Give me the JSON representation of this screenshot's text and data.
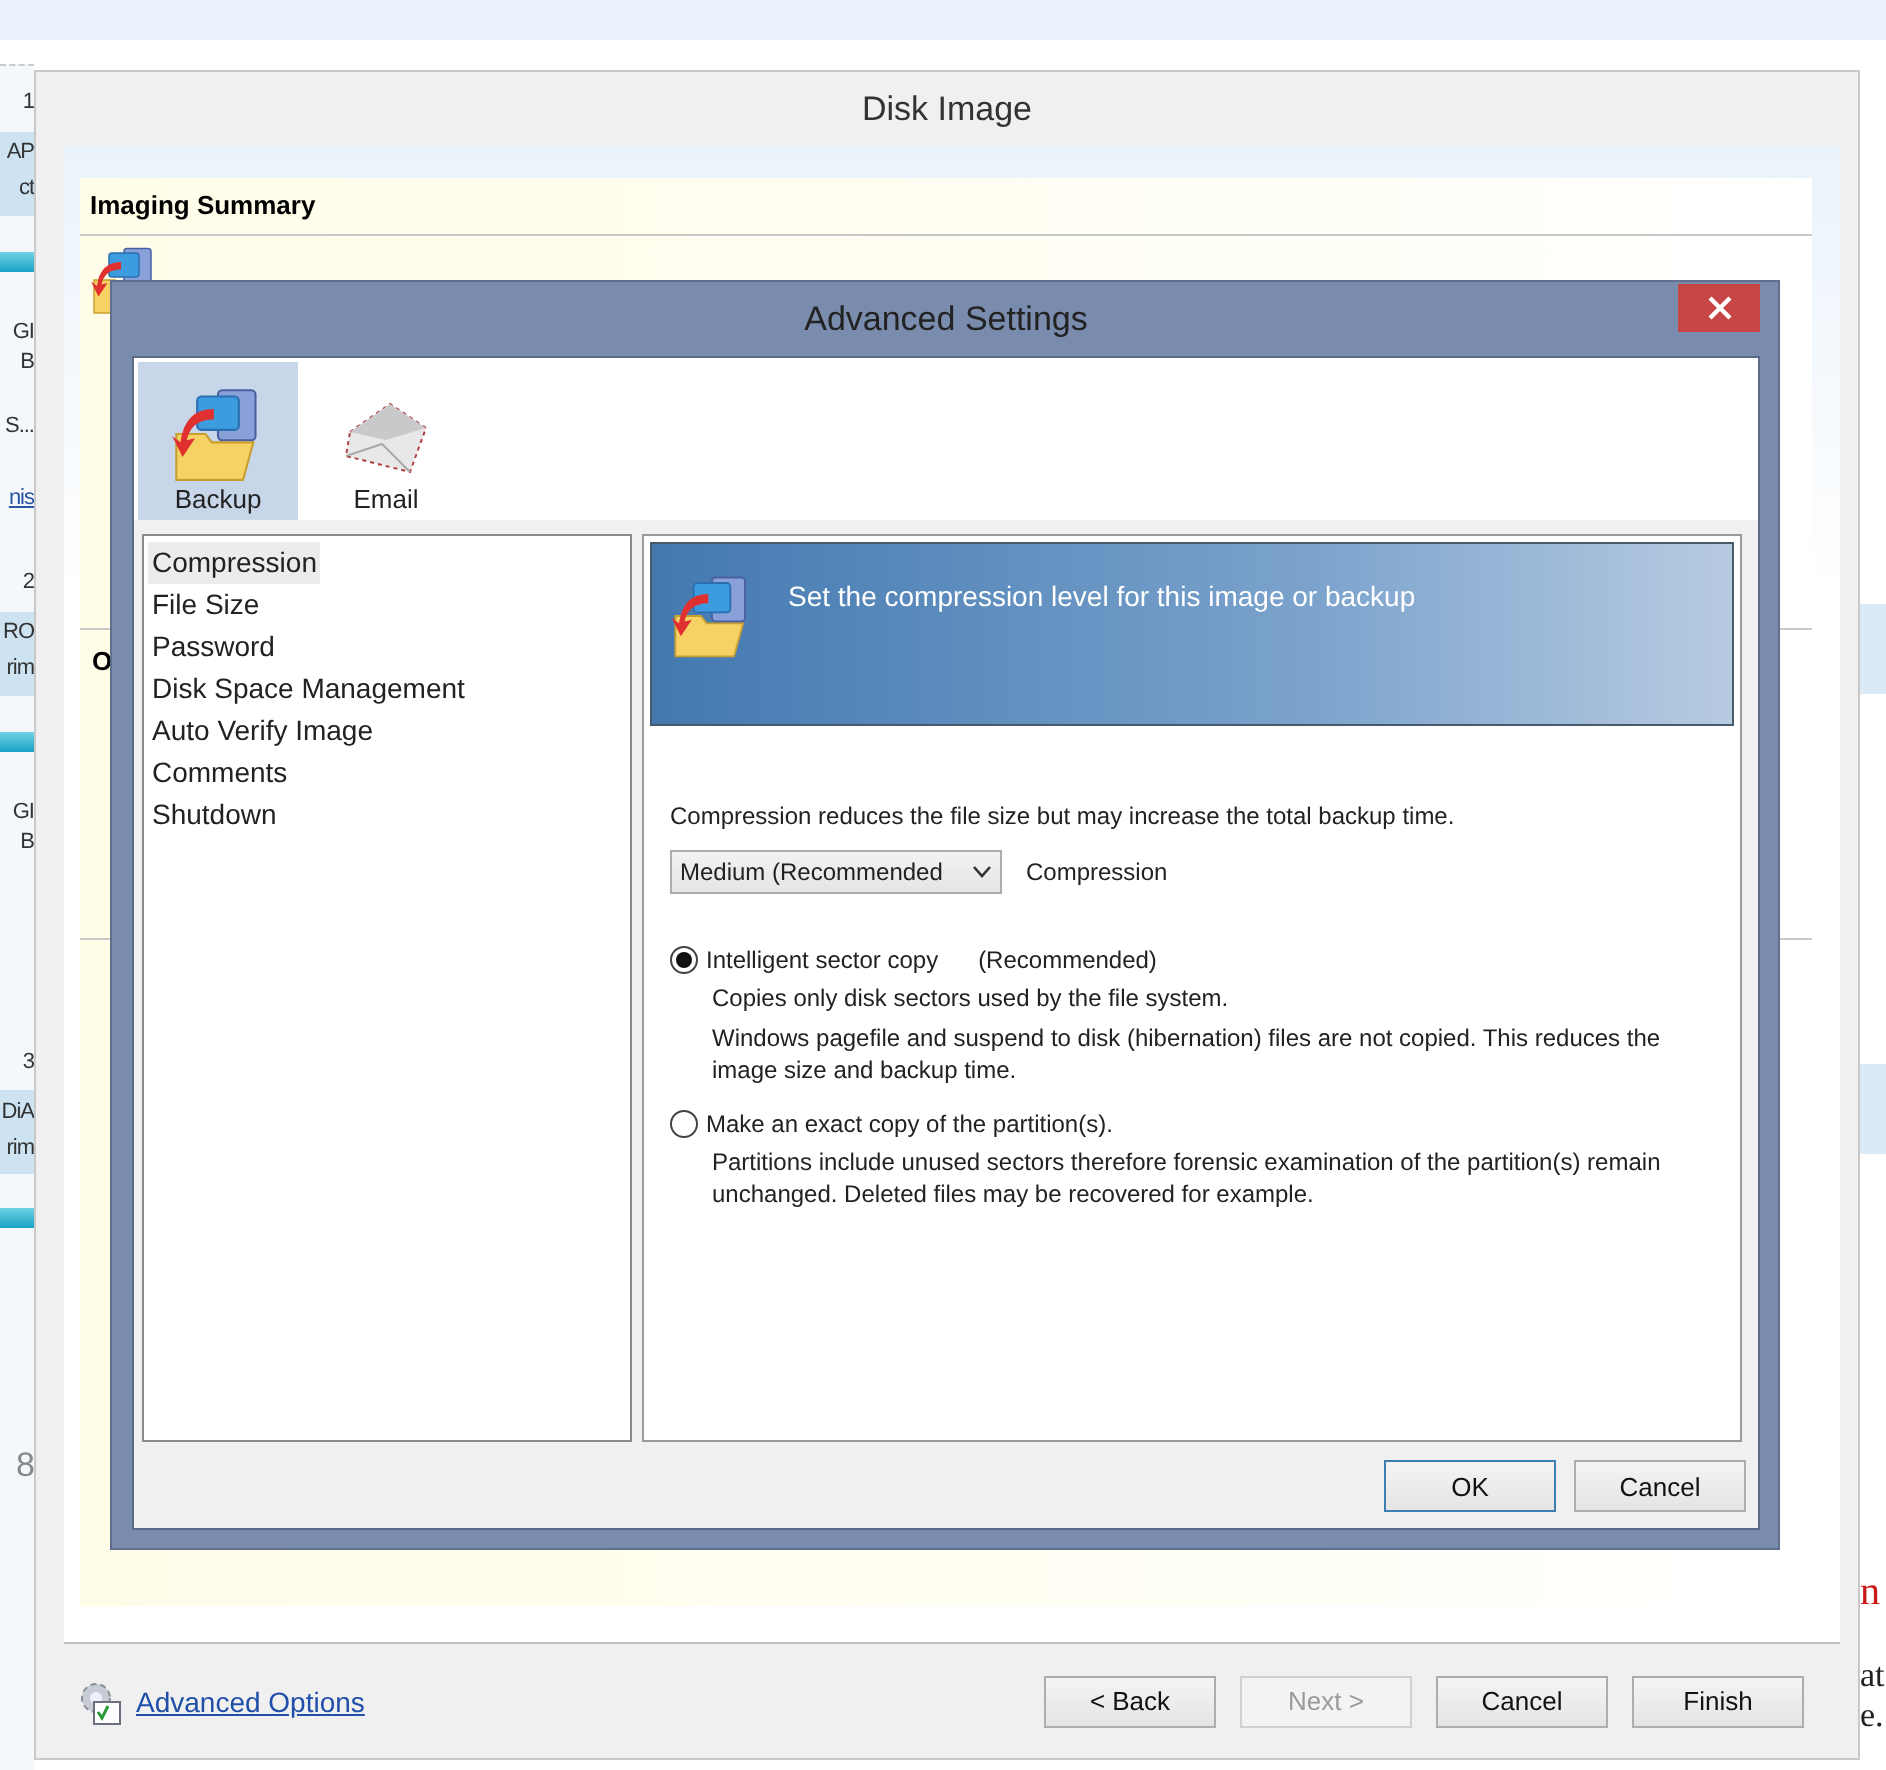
{
  "background_page": {
    "left_fragments": [
      {
        "text": "1",
        "kind": "text"
      },
      {
        "text": "AP",
        "kind": "text"
      },
      {
        "text": "ct",
        "kind": "text"
      },
      {
        "text": "GI",
        "kind": "text"
      },
      {
        "text": "B",
        "kind": "text"
      },
      {
        "text": "S...",
        "kind": "text"
      },
      {
        "text": "nis",
        "kind": "link"
      },
      {
        "text": "2",
        "kind": "text"
      },
      {
        "text": "RO",
        "kind": "text"
      },
      {
        "text": "rim",
        "kind": "text"
      },
      {
        "text": "GI",
        "kind": "text"
      },
      {
        "text": "B",
        "kind": "text"
      },
      {
        "text": "3",
        "kind": "text"
      },
      {
        "text": "DiA",
        "kind": "text"
      },
      {
        "text": "rim",
        "kind": "text"
      },
      {
        "text": "8",
        "kind": "number"
      }
    ],
    "right_fragments": [
      {
        "text": "n",
        "kind": "heading"
      },
      {
        "text": "at",
        "kind": "text"
      },
      {
        "text": "e.",
        "kind": "text"
      }
    ]
  },
  "window": {
    "title": "Disk Image",
    "summary": {
      "title": "Imaging Summary",
      "next_section_title": "O"
    },
    "advanced_options_link": "Advanced Options",
    "buttons": [
      {
        "label": "< Back",
        "disabled": false
      },
      {
        "label": "Next >",
        "disabled": true
      },
      {
        "label": "Cancel",
        "disabled": false
      },
      {
        "label": "Finish",
        "disabled": false
      }
    ]
  },
  "dialog": {
    "title": "Advanced Settings",
    "tabs": [
      {
        "label": "Backup",
        "kind": "backup",
        "selected": true
      },
      {
        "label": "Email",
        "kind": "email",
        "selected": false
      }
    ],
    "nav_items": [
      {
        "label": "Compression",
        "selected": true
      },
      {
        "label": "File Size",
        "selected": false
      },
      {
        "label": "Password",
        "selected": false
      },
      {
        "label": "Disk Space Management",
        "selected": false
      },
      {
        "label": "Auto Verify Image",
        "selected": false
      },
      {
        "label": "Comments",
        "selected": false
      },
      {
        "label": "Shutdown",
        "selected": false
      }
    ],
    "banner": "Set the compression level for this image or backup",
    "description": "Compression reduces the file size but may increase the total backup time.",
    "compression": {
      "value": "Medium (Recommended",
      "label": "Compression"
    },
    "options": [
      {
        "label": "Intelligent sector copy",
        "note": "(Recommended)",
        "selected": true,
        "details": [
          "Copies only disk sectors used by the file system.",
          "Windows pagefile and suspend to disk (hibernation) files are not copied. This reduces the image size and backup time."
        ]
      },
      {
        "label": "Make an exact copy of the partition(s).",
        "selected": false,
        "details": [
          "Partitions include unused sectors therefore forensic examination of the partition(s) remain unchanged. Deleted files may be recovered for example."
        ]
      }
    ],
    "buttons": [
      "OK",
      "Cancel"
    ]
  }
}
